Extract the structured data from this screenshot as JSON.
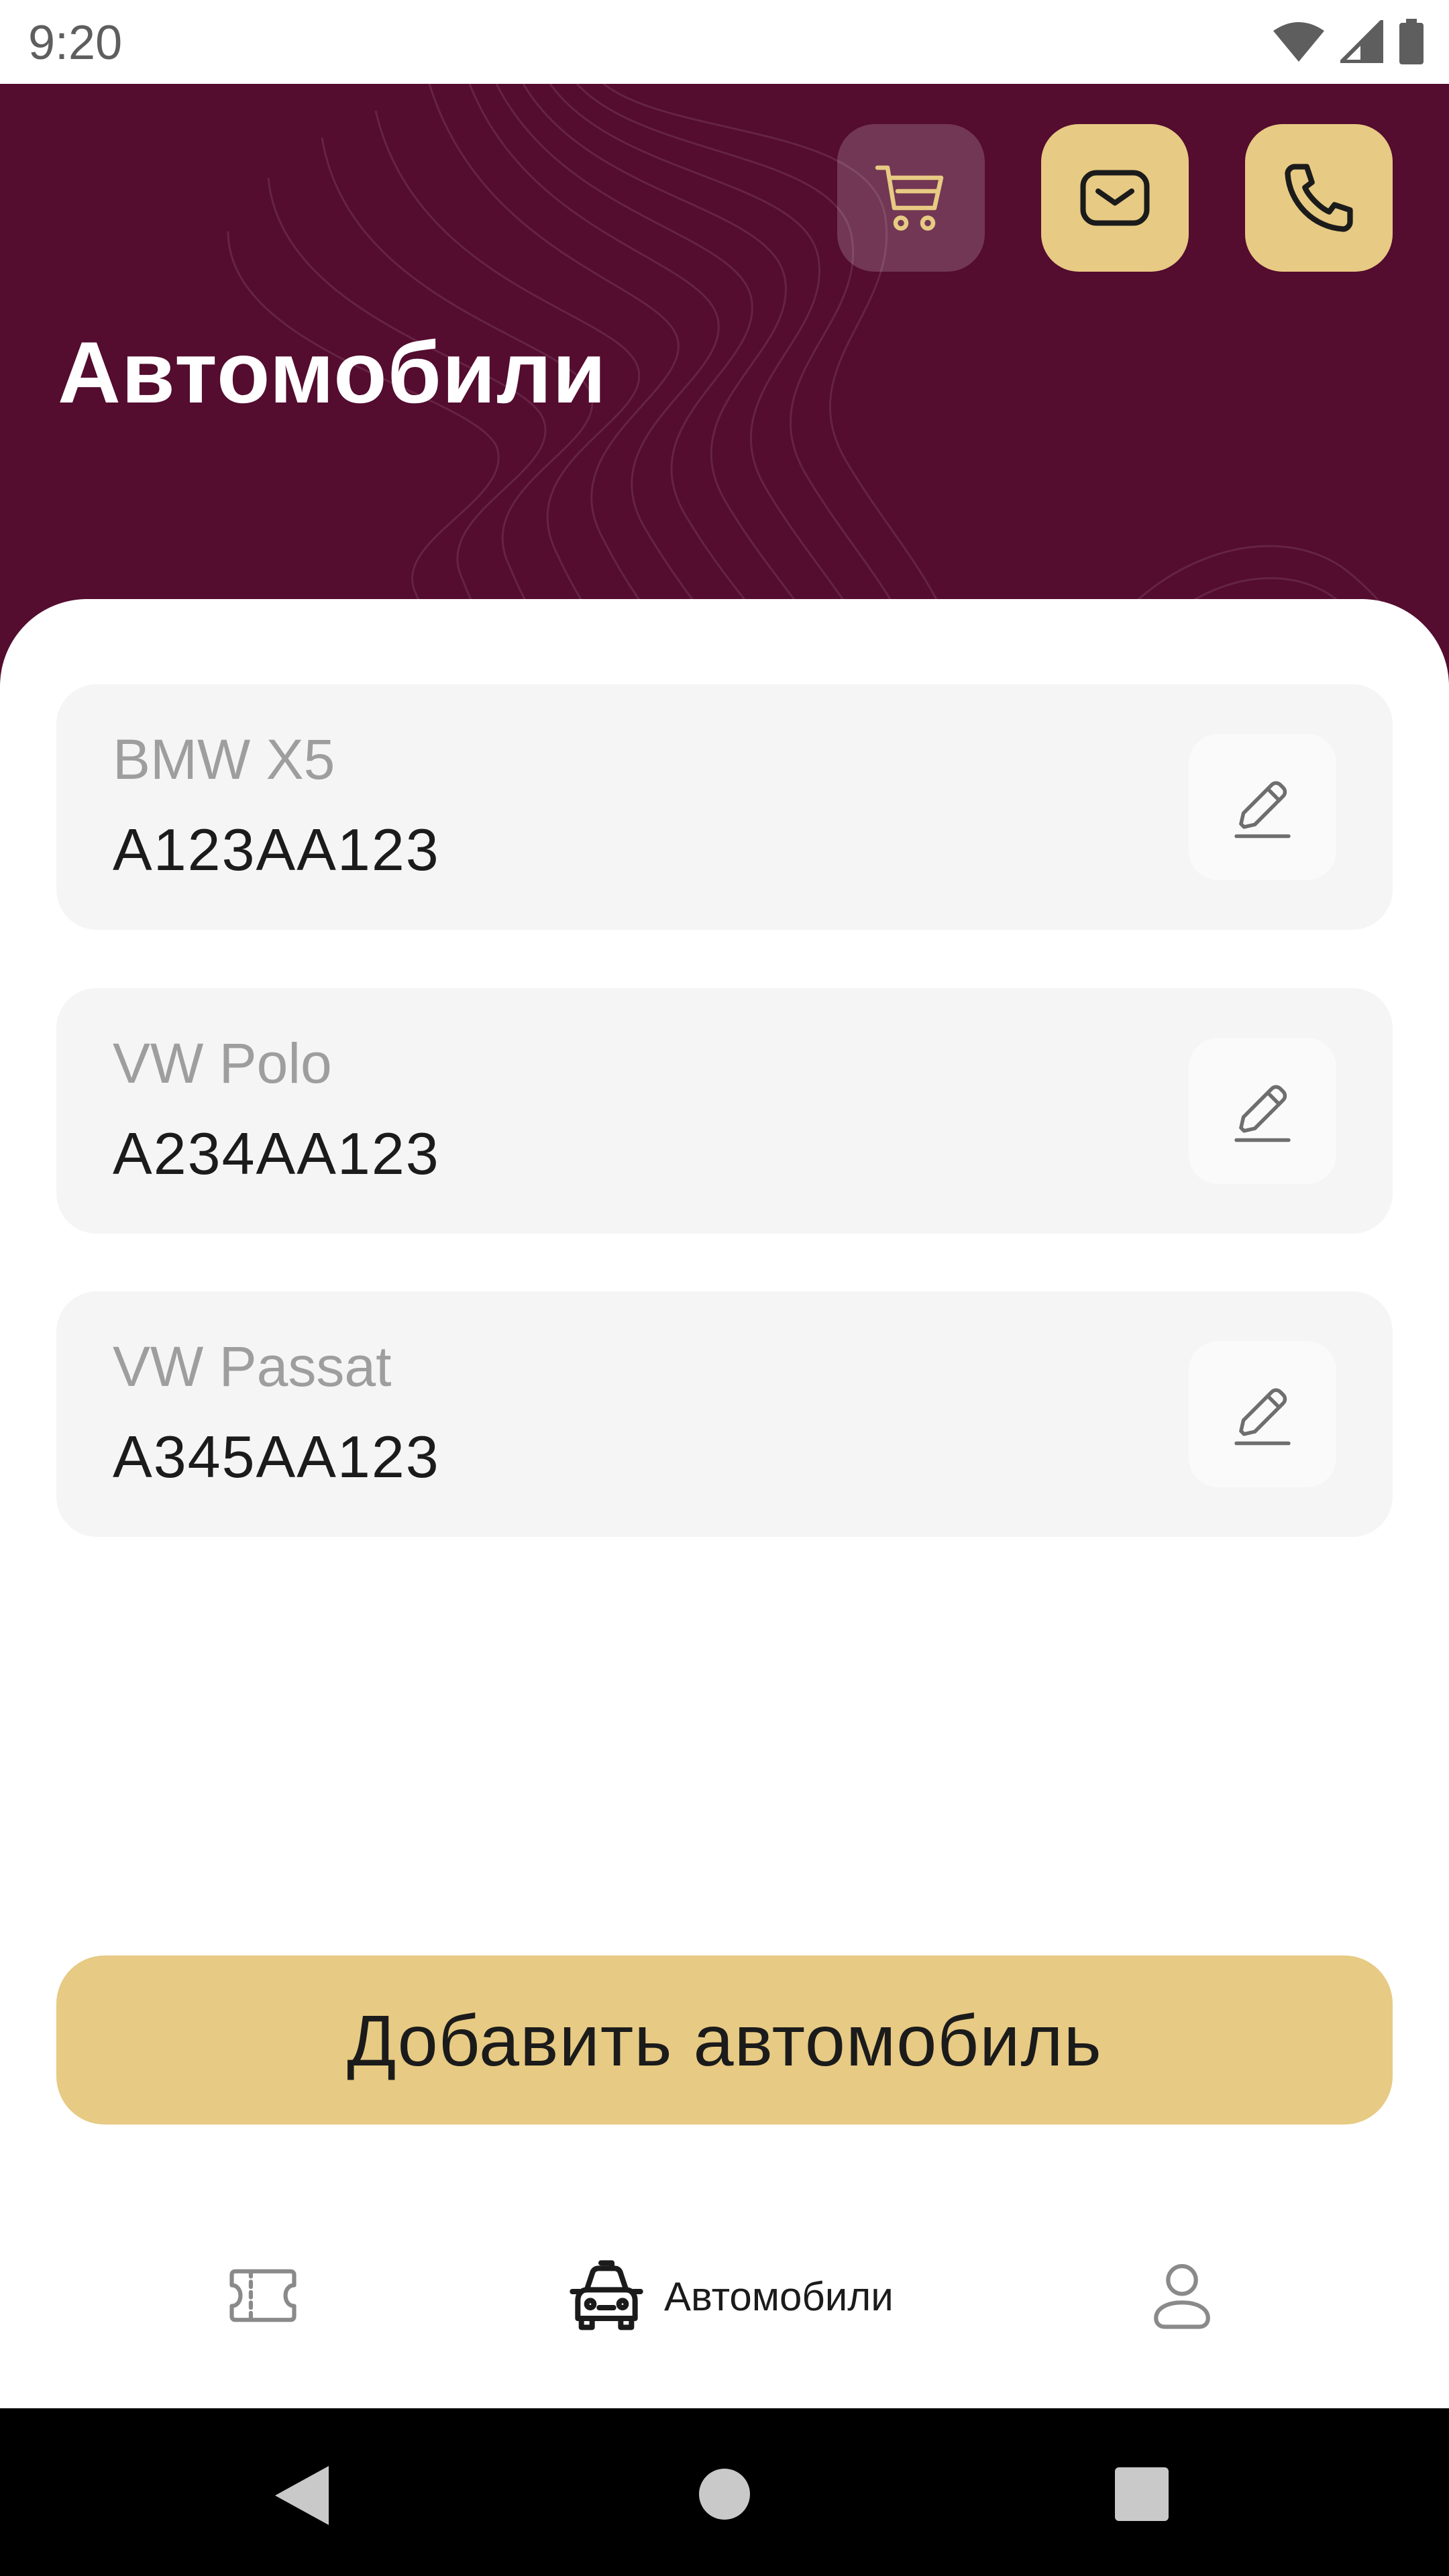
{
  "status_bar": {
    "time": "9:20",
    "icons": [
      "wifi-icon",
      "signal-icon",
      "battery-icon"
    ]
  },
  "header": {
    "title": "Автомобили",
    "buttons": [
      {
        "name": "cart",
        "icon": "cart-icon"
      },
      {
        "name": "mail",
        "icon": "mail-icon"
      },
      {
        "name": "phone",
        "icon": "phone-icon"
      }
    ],
    "colors": {
      "background": "#540c2f",
      "accent": "#e7ca83"
    }
  },
  "cars": [
    {
      "model": "BMW X5",
      "plate": "А123АА123"
    },
    {
      "model": "VW Polo",
      "plate": "А234АА123"
    },
    {
      "model": "VW Passat",
      "plate": "А345АА123"
    }
  ],
  "add_button": {
    "label": "Добавить автомобиль"
  },
  "bottom_nav": {
    "items": [
      {
        "name": "tickets",
        "icon": "ticket-icon",
        "label": ""
      },
      {
        "name": "cars",
        "icon": "car-icon",
        "label": "Автомобили",
        "active": true
      },
      {
        "name": "profile",
        "icon": "profile-icon",
        "label": ""
      }
    ]
  },
  "system_nav": [
    "back-icon",
    "home-icon",
    "recents-icon"
  ]
}
